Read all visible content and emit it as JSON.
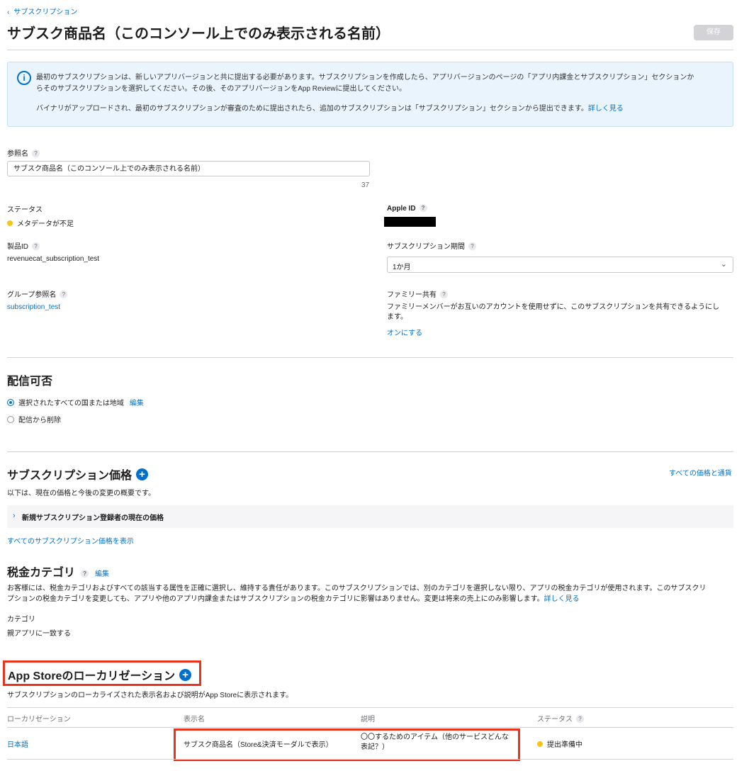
{
  "breadcrumb": {
    "back_label": "サブスクリプション"
  },
  "header": {
    "title": "サブスク商品名（このコンソール上でのみ表示される名前）",
    "save_label": "保存"
  },
  "notice": {
    "line1": "最初のサブスクリプションは、新しいアプリバージョンと共に提出する必要があります。サブスクリプションを作成したら、アプリバージョンのページの「アプリ内課金とサブスクリプション」セクションか",
    "line2": "らそのサブスクリプションを選択してください。その後、そのアプリバージョンをApp Reviewに提出してください。",
    "line3": "バイナリがアップロードされ、最初のサブスクリプションが審査のために提出されたら、追加のサブスクリプションは「サブスクリプション」セクションから提出できます。",
    "learn_more": "詳しく見る"
  },
  "reference_name": {
    "label": "参照名",
    "value": "サブスク商品名（このコンソール上でのみ表示される名前）",
    "char_count": "37"
  },
  "status": {
    "label": "ステータス",
    "value": "メタデータが不足"
  },
  "apple_id": {
    "label": "Apple ID"
  },
  "product_id": {
    "label": "製品ID",
    "value": "revenuecat_subscription_test"
  },
  "duration": {
    "label": "サブスクリプション期間",
    "value": "1か月"
  },
  "group_ref": {
    "label": "グループ参照名",
    "value": "subscription_test"
  },
  "family": {
    "label": "ファミリー共有",
    "desc1": "ファミリーメンバーがお互いのアカウントを使用せずに、このサブスクリプションを共有できるようにし",
    "desc2": "ます。",
    "action": "オンにする"
  },
  "availability": {
    "title": "配信可否",
    "option1": "選択されたすべての国または地域",
    "edit": "編集",
    "option2": "配信から削除"
  },
  "pricing": {
    "title": "サブスクリプション価格",
    "all_prices": "すべての価格と通貨",
    "subtitle": "以下は、現在の価格と今後の変更の概要です。",
    "row": "新規サブスクリプション登録者の現在の価格",
    "show_all": "すべてのサブスクリプション価格を表示"
  },
  "tax": {
    "title": "税金カテゴリ",
    "edit": "編集",
    "desc1": "お客様には、税金カテゴリおよびすべての該当する属性を正確に選択し、維持する責任があります。このサブスクリプションでは、別のカテゴリを選択しない限り、アプリの税金カテゴリが使用されます。このサブスクリ",
    "desc2": "プションの税金カテゴリを変更しても、アプリや他のアプリ内課金またはサブスクリプションの税金カテゴリに影響はありません。変更は将来の売上にのみ影響します。",
    "learn_more": "詳しく見る",
    "category_label": "カテゴリ",
    "category_value": "親アプリに一致する"
  },
  "localization": {
    "title": "App Storeのローカリゼーション",
    "subtitle": "サブスクリプションのローカライズされた表示名および説明がApp Storeに表示されます。",
    "columns": {
      "loc": "ローカリゼーション",
      "name": "表示名",
      "desc": "説明",
      "status": "ステータス"
    },
    "rows": [
      {
        "loc": "日本語",
        "name": "サブスク商品名（Store&決済モーダルで表示）",
        "desc1": "〇〇するためのアイテム（他のサービスどんな",
        "desc2": "表記？）",
        "status": "提出準備中"
      }
    ]
  },
  "colors": {
    "accent": "#0070c9",
    "highlight": "#e8341c",
    "warning": "#f5c518",
    "notice_bg": "#eaf4fd"
  }
}
